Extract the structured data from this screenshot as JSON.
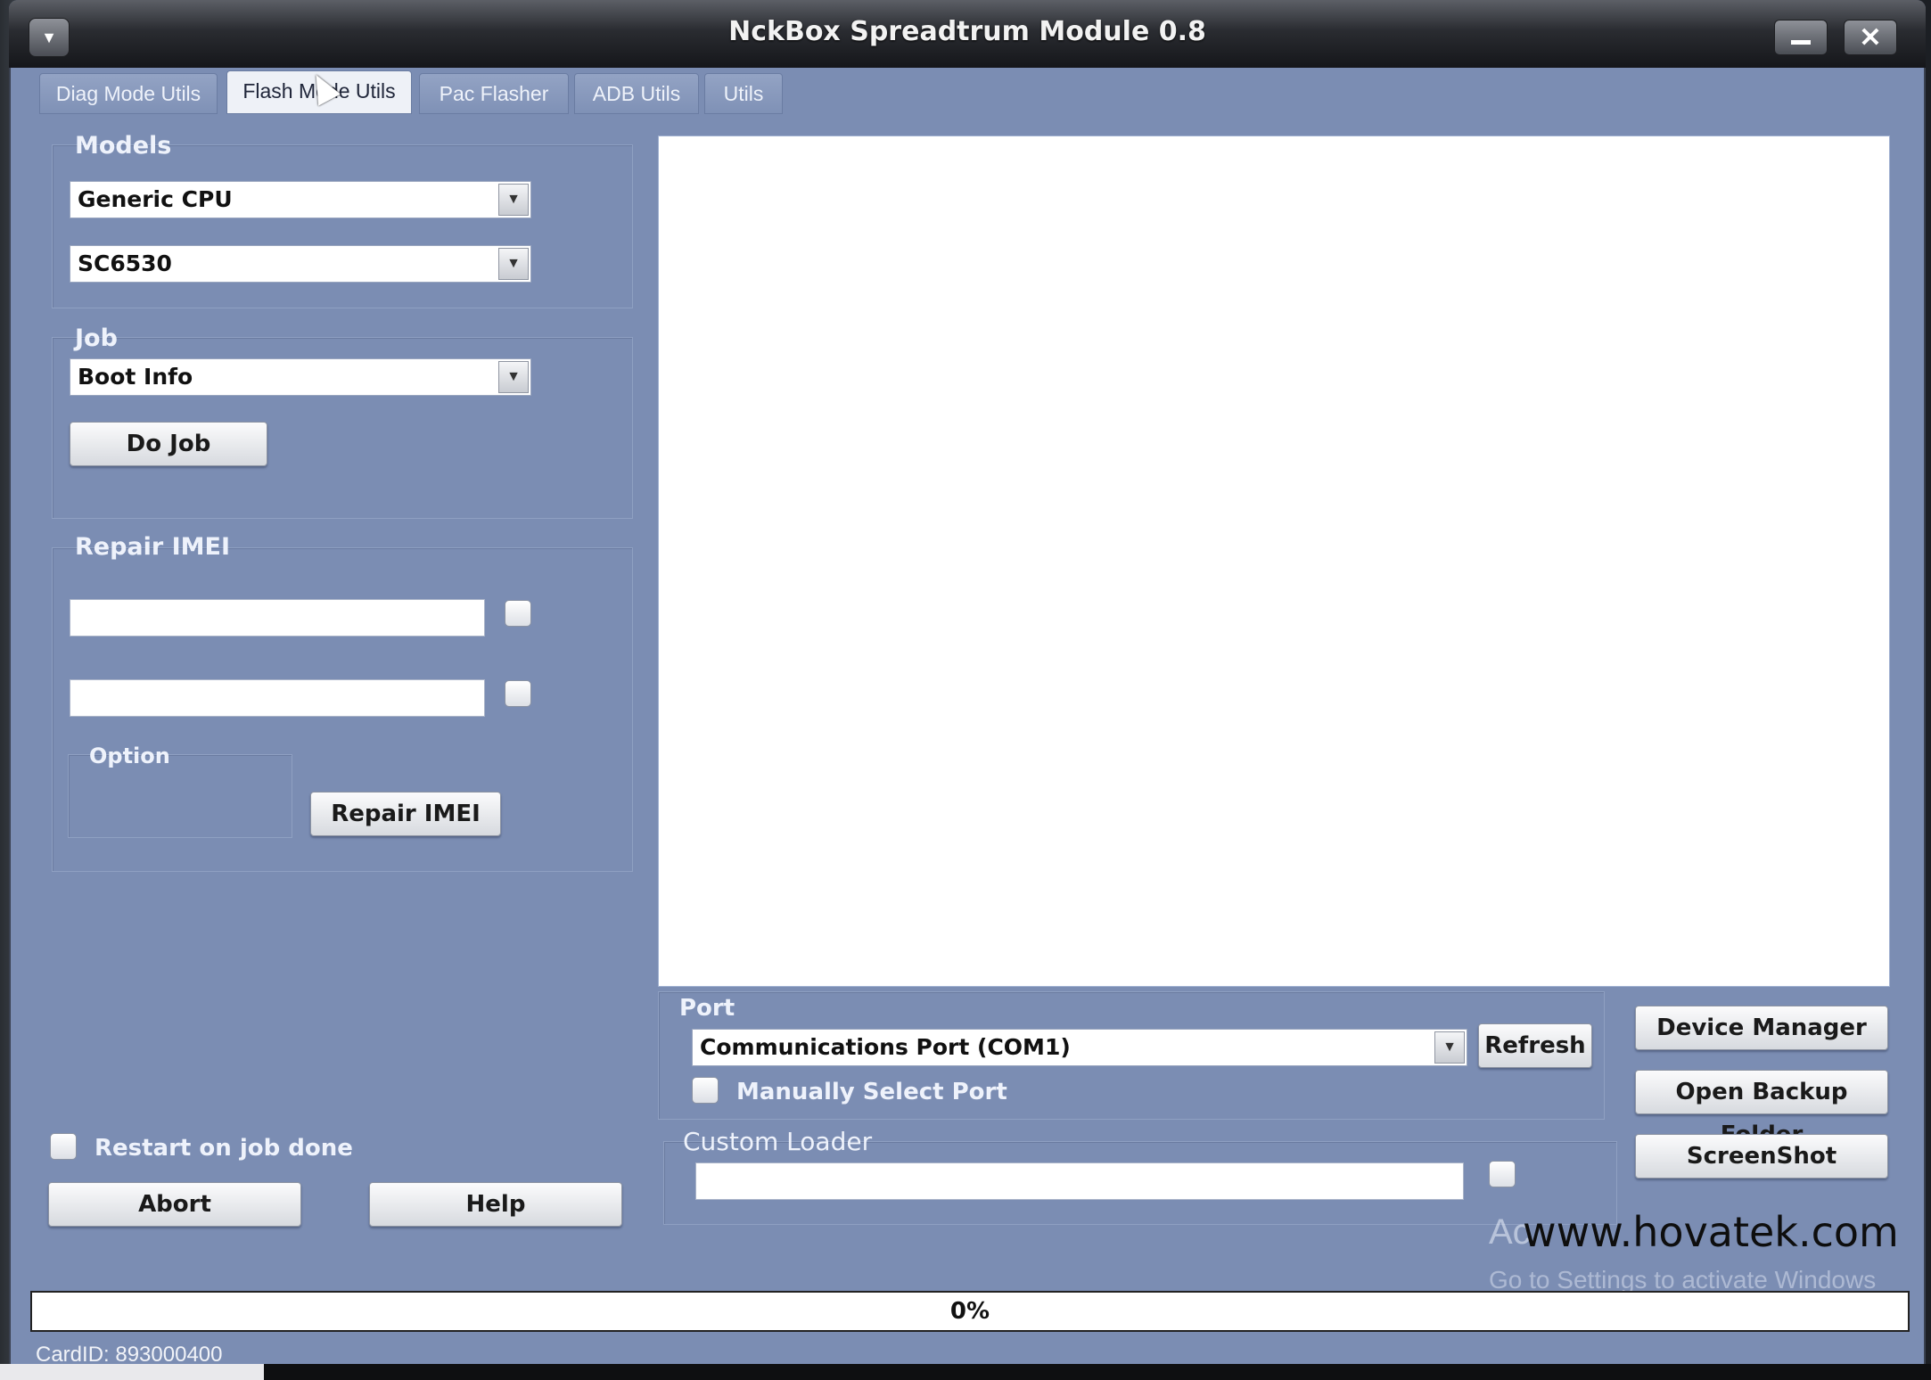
{
  "window": {
    "title": "NckBox Spreadtrum Module 0.8"
  },
  "tabs": [
    {
      "label": "Diag Mode Utils"
    },
    {
      "label": "Flash Mode Utils"
    },
    {
      "label": "Pac Flasher"
    },
    {
      "label": "ADB Utils"
    },
    {
      "label": "Utils"
    }
  ],
  "models": {
    "label": "Models",
    "brand": "Generic CPU",
    "model": "SC6530"
  },
  "job": {
    "label": "Job",
    "selected": "Boot Info",
    "do_job_label": "Do Job"
  },
  "repair_imei": {
    "label": "Repair IMEI",
    "imei1": "",
    "imei2": "",
    "option_label": "Option",
    "button_label": "Repair IMEI"
  },
  "left_bottom": {
    "restart_label": "Restart on job done",
    "abort_label": "Abort",
    "help_label": "Help"
  },
  "port": {
    "label": "Port",
    "selected": "Communications Port (COM1)",
    "refresh_label": "Refresh",
    "manual_label": "Manually Select Port"
  },
  "custom_loader": {
    "label": "Custom Loader",
    "value": ""
  },
  "side_buttons": {
    "device_manager": "Device Manager",
    "open_backup": "Open Backup Folder",
    "screenshot": "ScreenShot"
  },
  "progress": {
    "text": "0%",
    "value": 0
  },
  "status": {
    "card_id": "CardID: 893000400"
  },
  "overlay": {
    "watermark": "www.hovatek.com",
    "activate_title": "Ac",
    "activate_sub": "Go to Settings to activate Windows"
  },
  "colors": {
    "window_bg": "#7b8db3",
    "titlebar": "#2a2c31"
  }
}
